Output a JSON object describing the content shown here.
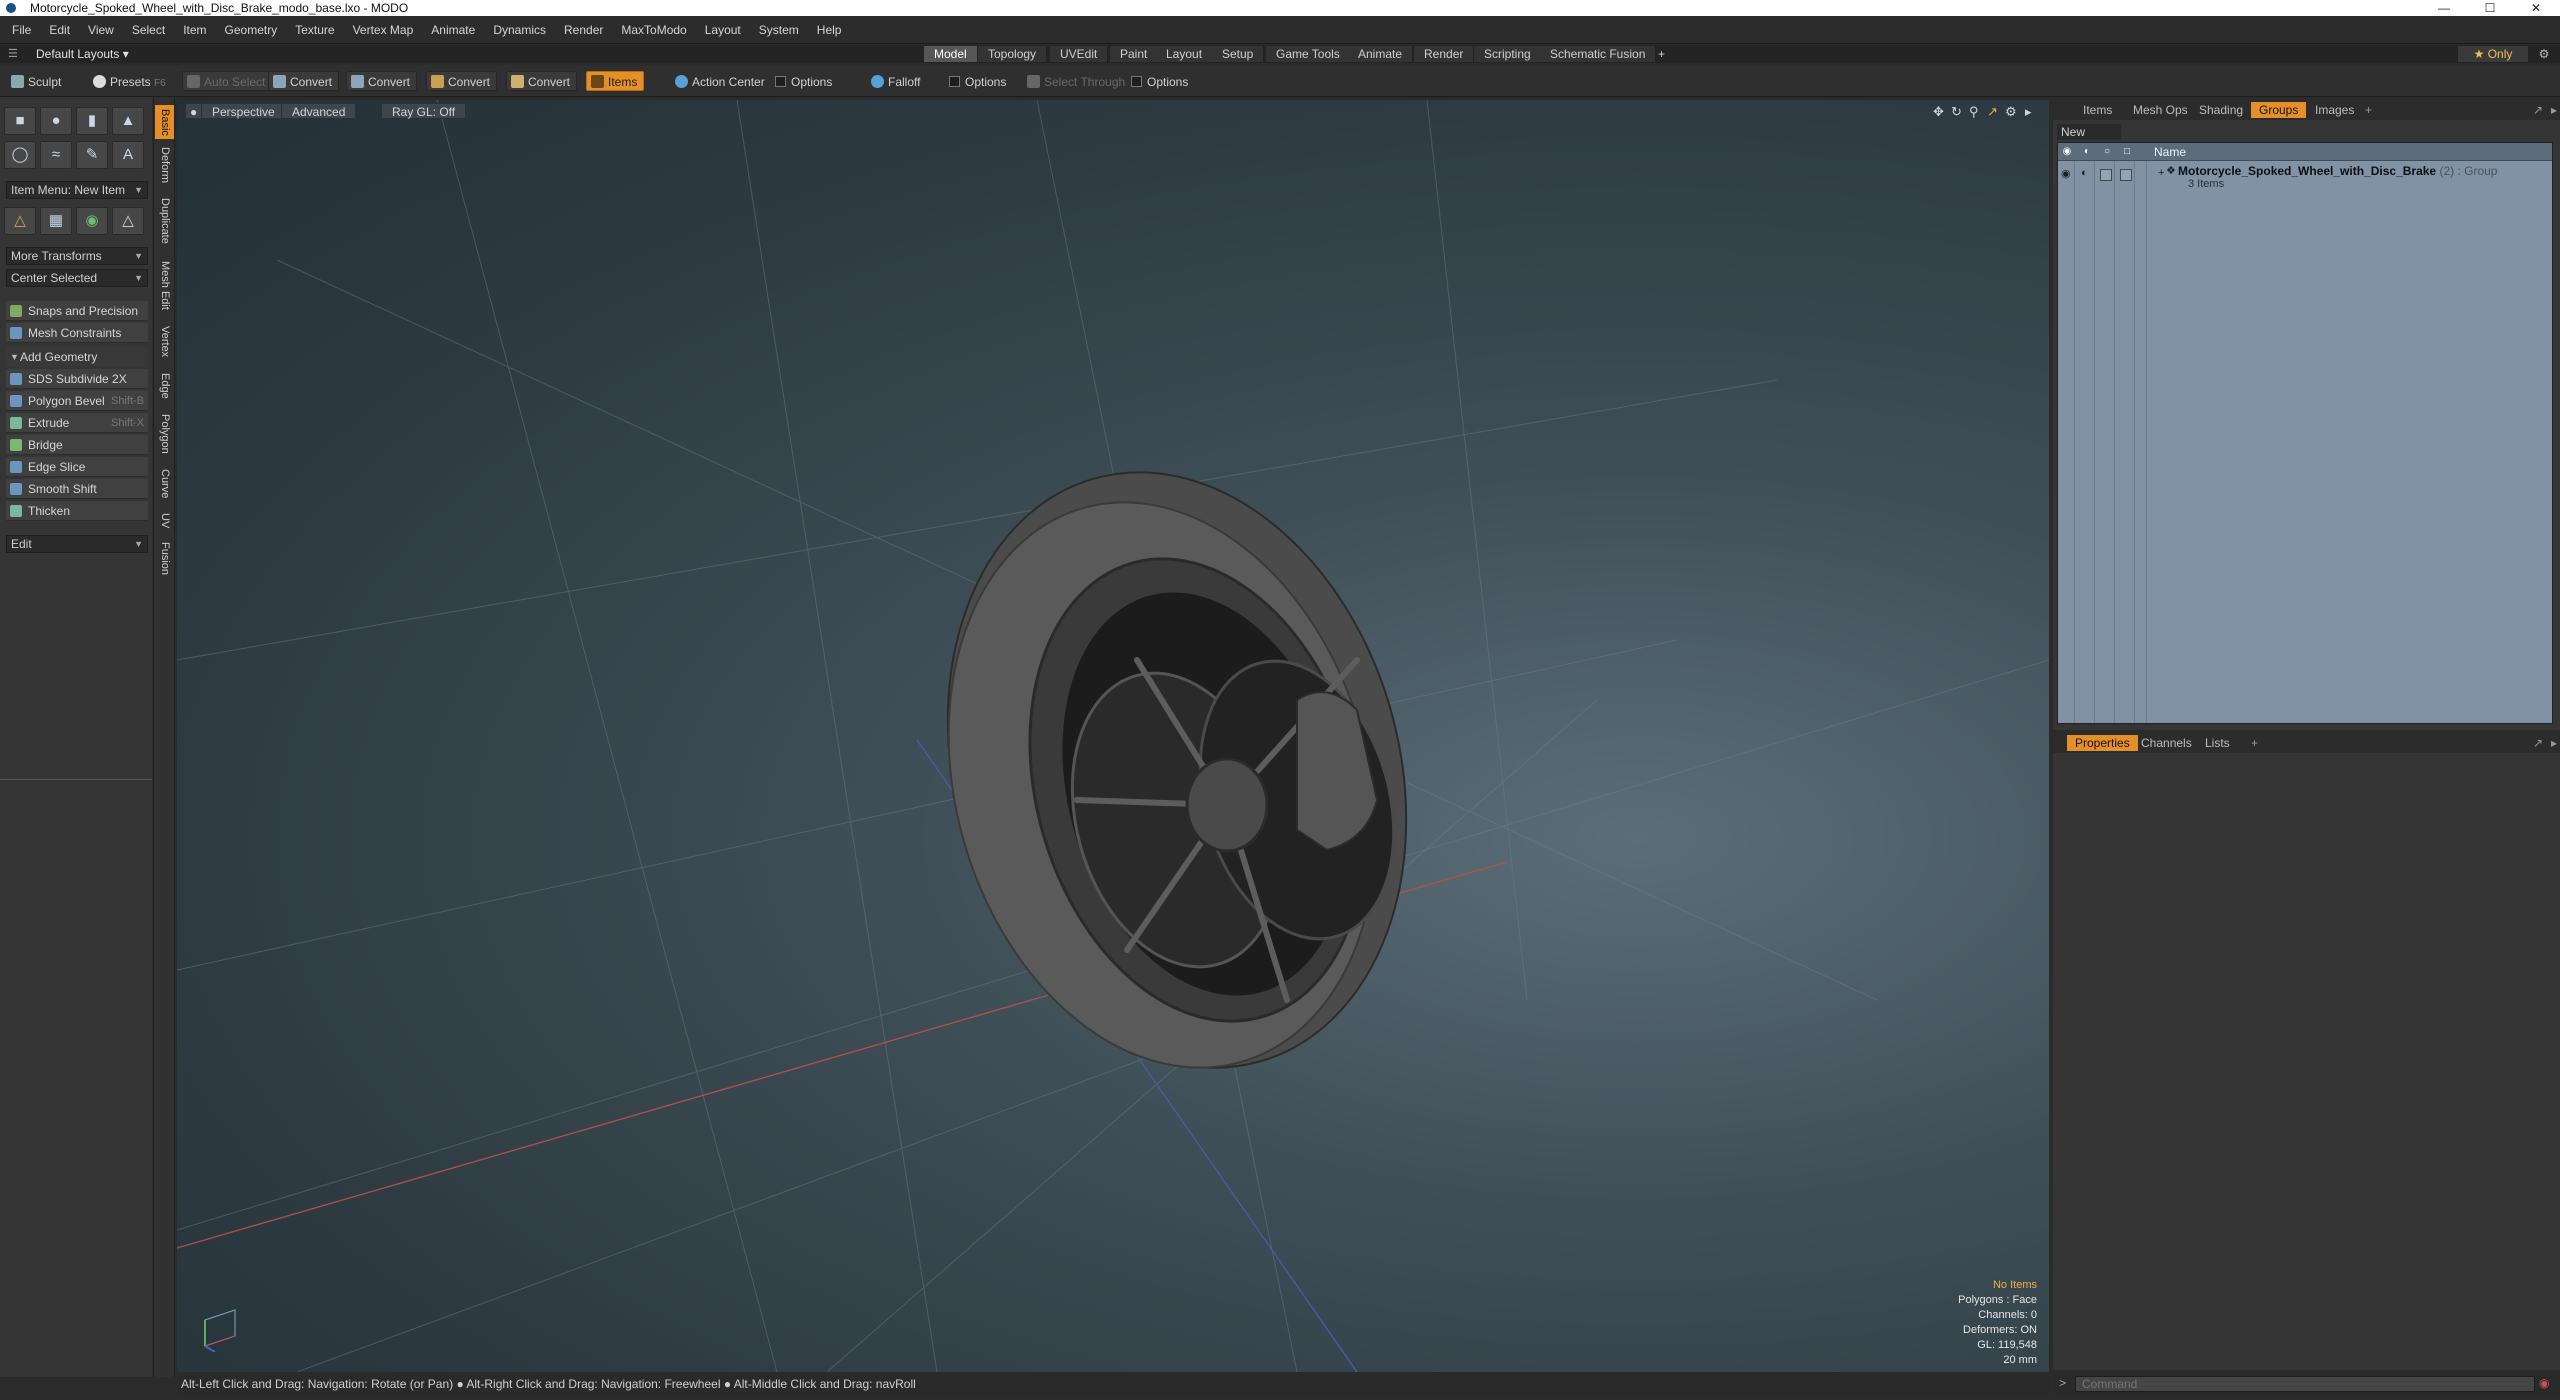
{
  "titlebar": {
    "title": "Motorcycle_Spoked_Wheel_with_Disc_Brake_modo_base.lxo - MODO"
  },
  "menu": [
    "File",
    "Edit",
    "View",
    "Select",
    "Item",
    "Geometry",
    "Texture",
    "Vertex Map",
    "Animate",
    "Dynamics",
    "Render",
    "MaxToModo",
    "Layout",
    "System",
    "Help"
  ],
  "layout": {
    "dropdown": "Default Layouts",
    "tabs": [
      "Model",
      "Topology",
      "UVEdit",
      "Paint",
      "Layout",
      "Setup",
      "Game Tools",
      "Animate",
      "Render",
      "Scripting",
      "Schematic Fusion"
    ],
    "active_tab": "Model",
    "only_label": "Only"
  },
  "toolbar": {
    "sculpt": "Sculpt",
    "presets": "Presets",
    "presets_key": "F6",
    "auto_select": "Auto Select",
    "convert": "Convert",
    "items": "Items",
    "action_center": "Action Center",
    "options": "Options",
    "falloff": "Falloff",
    "select_through": "Select Through"
  },
  "leftpanel": {
    "item_menu": "Item Menu: New Item",
    "more_transforms": "More Transforms",
    "center_selected": "Center Selected",
    "snaps": "Snaps and Precision",
    "mesh_constraints": "Mesh Constraints",
    "add_geometry": "Add Geometry",
    "tools": [
      {
        "label": "SDS Subdivide 2X",
        "shortcut": ""
      },
      {
        "label": "Polygon Bevel",
        "shortcut": "Shift-B"
      },
      {
        "label": "Extrude",
        "shortcut": "Shift-X"
      },
      {
        "label": "Bridge",
        "shortcut": ""
      },
      {
        "label": "Edge Slice",
        "shortcut": ""
      },
      {
        "label": "Smooth Shift",
        "shortcut": ""
      },
      {
        "label": "Thicken",
        "shortcut": ""
      }
    ],
    "edit": "Edit"
  },
  "vtabs": [
    "Basic",
    "Deform",
    "Duplicate",
    "Mesh Edit",
    "Vertex",
    "Edge",
    "Polygon",
    "Curve",
    "UV",
    "Fusion"
  ],
  "viewport": {
    "view": "Perspective",
    "mode": "Advanced",
    "raygl": "Ray GL: Off",
    "stats": {
      "items": "No Items",
      "polygons": "Polygons : Face",
      "channels": "Channels: 0",
      "deformers": "Deformers: ON",
      "gl": "GL: 119,548",
      "scale": "20 mm"
    }
  },
  "statusbar": "Alt-Left Click and Drag: Navigation: Rotate (or Pan) ● Alt-Right Click and Drag: Navigation: Freewheel ● Alt-Middle Click and Drag: navRoll",
  "rightpanel": {
    "tabs": [
      "Items",
      "Mesh Ops",
      "Shading",
      "Groups",
      "Images"
    ],
    "active_tab": "Groups",
    "new_group": "New Group",
    "column_name": "Name",
    "group": {
      "name": "Motorcycle_Spoked_Wheel_with_Disc_Brake",
      "type": "(2) : Group",
      "count": "3 Items"
    }
  },
  "propanel": {
    "tabs": [
      "Properties",
      "Channels",
      "Lists"
    ],
    "active_tab": "Properties"
  },
  "command": {
    "placeholder": "Command"
  },
  "colors": {
    "accent": "#e3902a",
    "viewport_top": "#3f4f58",
    "group_tree": "#8192a4"
  }
}
